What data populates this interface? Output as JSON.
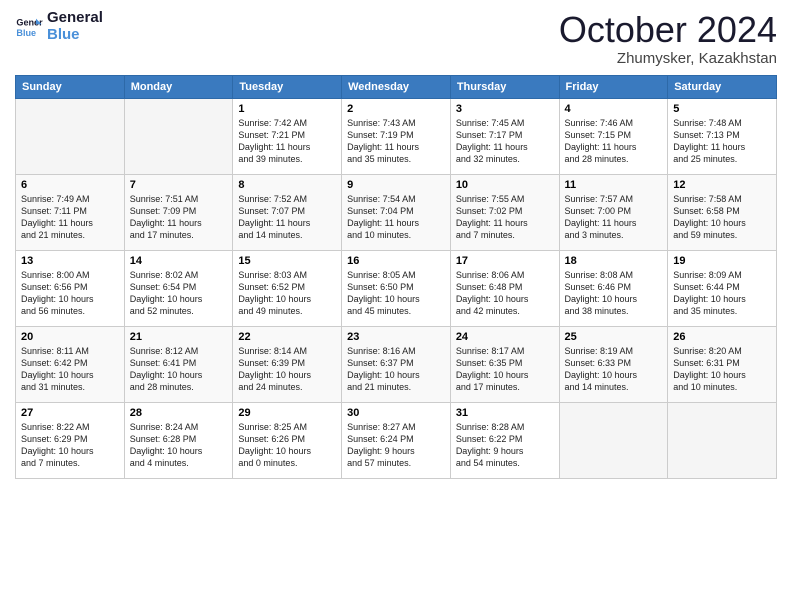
{
  "header": {
    "logo_line1": "General",
    "logo_line2": "Blue",
    "month_title": "October 2024",
    "location": "Zhumysker, Kazakhstan"
  },
  "days_of_week": [
    "Sunday",
    "Monday",
    "Tuesday",
    "Wednesday",
    "Thursday",
    "Friday",
    "Saturday"
  ],
  "weeks": [
    [
      {
        "day": "",
        "info": ""
      },
      {
        "day": "",
        "info": ""
      },
      {
        "day": "1",
        "info": "Sunrise: 7:42 AM\nSunset: 7:21 PM\nDaylight: 11 hours\nand 39 minutes."
      },
      {
        "day": "2",
        "info": "Sunrise: 7:43 AM\nSunset: 7:19 PM\nDaylight: 11 hours\nand 35 minutes."
      },
      {
        "day": "3",
        "info": "Sunrise: 7:45 AM\nSunset: 7:17 PM\nDaylight: 11 hours\nand 32 minutes."
      },
      {
        "day": "4",
        "info": "Sunrise: 7:46 AM\nSunset: 7:15 PM\nDaylight: 11 hours\nand 28 minutes."
      },
      {
        "day": "5",
        "info": "Sunrise: 7:48 AM\nSunset: 7:13 PM\nDaylight: 11 hours\nand 25 minutes."
      }
    ],
    [
      {
        "day": "6",
        "info": "Sunrise: 7:49 AM\nSunset: 7:11 PM\nDaylight: 11 hours\nand 21 minutes."
      },
      {
        "day": "7",
        "info": "Sunrise: 7:51 AM\nSunset: 7:09 PM\nDaylight: 11 hours\nand 17 minutes."
      },
      {
        "day": "8",
        "info": "Sunrise: 7:52 AM\nSunset: 7:07 PM\nDaylight: 11 hours\nand 14 minutes."
      },
      {
        "day": "9",
        "info": "Sunrise: 7:54 AM\nSunset: 7:04 PM\nDaylight: 11 hours\nand 10 minutes."
      },
      {
        "day": "10",
        "info": "Sunrise: 7:55 AM\nSunset: 7:02 PM\nDaylight: 11 hours\nand 7 minutes."
      },
      {
        "day": "11",
        "info": "Sunrise: 7:57 AM\nSunset: 7:00 PM\nDaylight: 11 hours\nand 3 minutes."
      },
      {
        "day": "12",
        "info": "Sunrise: 7:58 AM\nSunset: 6:58 PM\nDaylight: 10 hours\nand 59 minutes."
      }
    ],
    [
      {
        "day": "13",
        "info": "Sunrise: 8:00 AM\nSunset: 6:56 PM\nDaylight: 10 hours\nand 56 minutes."
      },
      {
        "day": "14",
        "info": "Sunrise: 8:02 AM\nSunset: 6:54 PM\nDaylight: 10 hours\nand 52 minutes."
      },
      {
        "day": "15",
        "info": "Sunrise: 8:03 AM\nSunset: 6:52 PM\nDaylight: 10 hours\nand 49 minutes."
      },
      {
        "day": "16",
        "info": "Sunrise: 8:05 AM\nSunset: 6:50 PM\nDaylight: 10 hours\nand 45 minutes."
      },
      {
        "day": "17",
        "info": "Sunrise: 8:06 AM\nSunset: 6:48 PM\nDaylight: 10 hours\nand 42 minutes."
      },
      {
        "day": "18",
        "info": "Sunrise: 8:08 AM\nSunset: 6:46 PM\nDaylight: 10 hours\nand 38 minutes."
      },
      {
        "day": "19",
        "info": "Sunrise: 8:09 AM\nSunset: 6:44 PM\nDaylight: 10 hours\nand 35 minutes."
      }
    ],
    [
      {
        "day": "20",
        "info": "Sunrise: 8:11 AM\nSunset: 6:42 PM\nDaylight: 10 hours\nand 31 minutes."
      },
      {
        "day": "21",
        "info": "Sunrise: 8:12 AM\nSunset: 6:41 PM\nDaylight: 10 hours\nand 28 minutes."
      },
      {
        "day": "22",
        "info": "Sunrise: 8:14 AM\nSunset: 6:39 PM\nDaylight: 10 hours\nand 24 minutes."
      },
      {
        "day": "23",
        "info": "Sunrise: 8:16 AM\nSunset: 6:37 PM\nDaylight: 10 hours\nand 21 minutes."
      },
      {
        "day": "24",
        "info": "Sunrise: 8:17 AM\nSunset: 6:35 PM\nDaylight: 10 hours\nand 17 minutes."
      },
      {
        "day": "25",
        "info": "Sunrise: 8:19 AM\nSunset: 6:33 PM\nDaylight: 10 hours\nand 14 minutes."
      },
      {
        "day": "26",
        "info": "Sunrise: 8:20 AM\nSunset: 6:31 PM\nDaylight: 10 hours\nand 10 minutes."
      }
    ],
    [
      {
        "day": "27",
        "info": "Sunrise: 8:22 AM\nSunset: 6:29 PM\nDaylight: 10 hours\nand 7 minutes."
      },
      {
        "day": "28",
        "info": "Sunrise: 8:24 AM\nSunset: 6:28 PM\nDaylight: 10 hours\nand 4 minutes."
      },
      {
        "day": "29",
        "info": "Sunrise: 8:25 AM\nSunset: 6:26 PM\nDaylight: 10 hours\nand 0 minutes."
      },
      {
        "day": "30",
        "info": "Sunrise: 8:27 AM\nSunset: 6:24 PM\nDaylight: 9 hours\nand 57 minutes."
      },
      {
        "day": "31",
        "info": "Sunrise: 8:28 AM\nSunset: 6:22 PM\nDaylight: 9 hours\nand 54 minutes."
      },
      {
        "day": "",
        "info": ""
      },
      {
        "day": "",
        "info": ""
      }
    ]
  ]
}
